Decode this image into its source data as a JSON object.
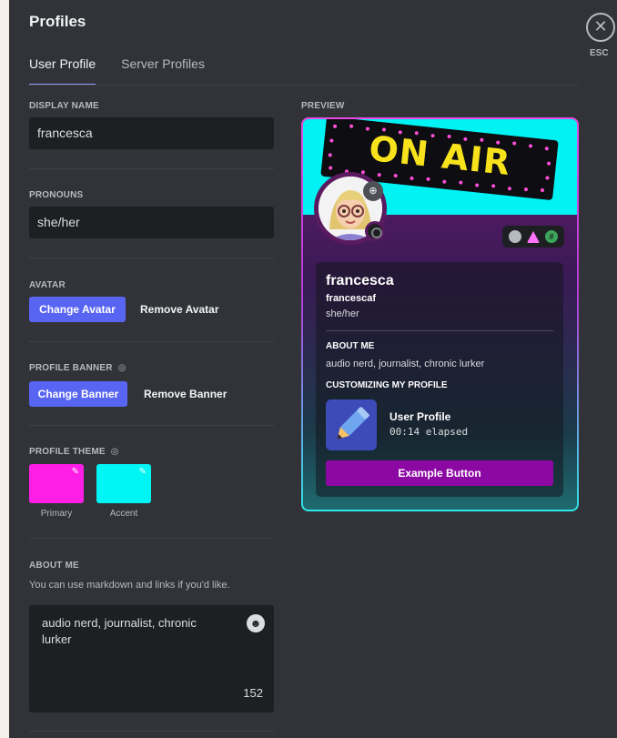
{
  "header": {
    "title": "Profiles",
    "close_icon": "close-icon",
    "esc_label": "ESC"
  },
  "tabs": [
    {
      "label": "User Profile",
      "active": true
    },
    {
      "label": "Server Profiles",
      "active": false
    }
  ],
  "display_name": {
    "label": "DISPLAY NAME",
    "value": "francesca"
  },
  "pronouns": {
    "label": "PRONOUNS",
    "value": "she/her"
  },
  "avatar": {
    "label": "AVATAR",
    "change_label": "Change Avatar",
    "remove_label": "Remove Avatar"
  },
  "banner": {
    "label": "PROFILE BANNER",
    "change_label": "Change Banner",
    "remove_label": "Remove Banner",
    "icon": "nitro-icon"
  },
  "theme": {
    "label": "PROFILE THEME",
    "icon": "nitro-icon",
    "primary": {
      "label": "Primary",
      "color": "#ff1ee6"
    },
    "accent": {
      "label": "Accent",
      "color": "#00f5f5"
    }
  },
  "about_me": {
    "label": "ABOUT ME",
    "help": "You can use markdown and links if you'd like.",
    "value": "audio nerd, journalist, chronic lurker",
    "char_count": "152"
  },
  "preview": {
    "label": "PREVIEW",
    "banner_text": "ON AIR",
    "name": "francesca",
    "username": "francescaf",
    "pronouns": "she/her",
    "about_label": "ABOUT ME",
    "about_text": "audio nerd, journalist, chronic lurker",
    "customizing_label": "CUSTOMIZING MY PROFILE",
    "activity_title": "User Profile",
    "activity_elapsed": "00:14 elapsed",
    "button_label": "Example Button",
    "colors": {
      "brand": "#5865f2",
      "example_button": "#8c08a3"
    }
  }
}
